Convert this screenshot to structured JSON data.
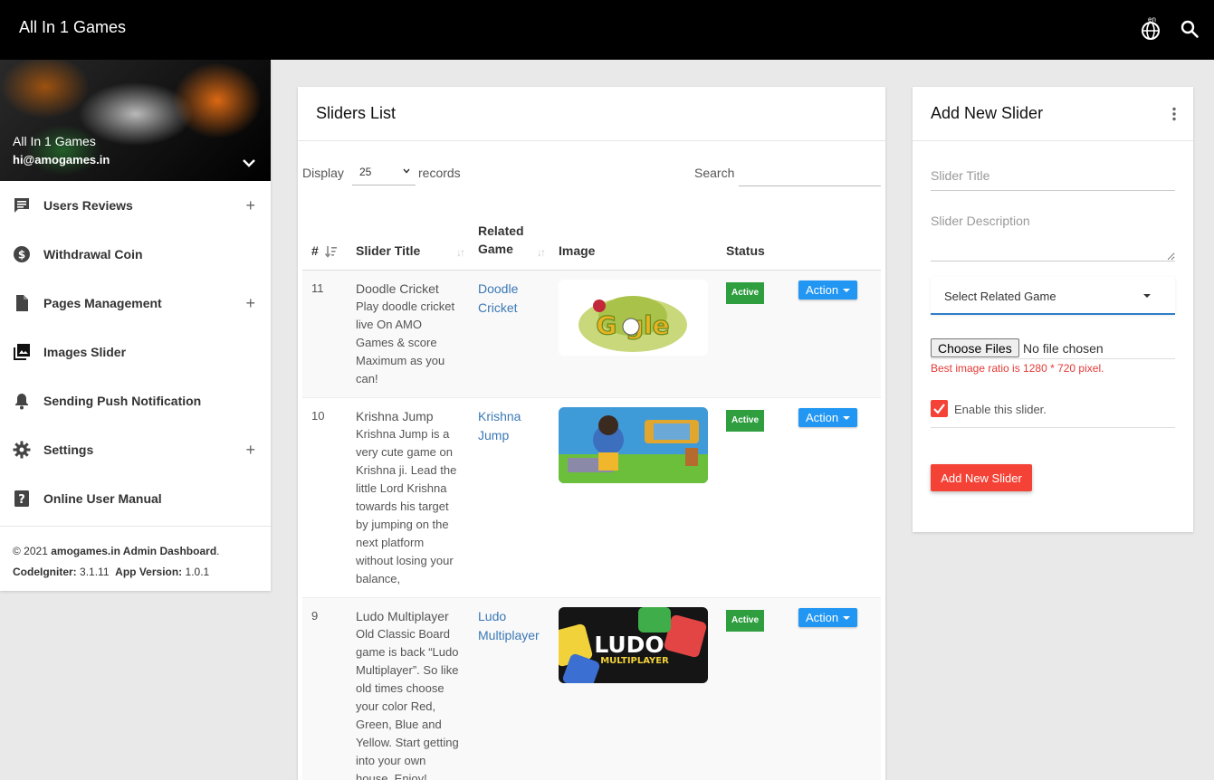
{
  "header": {
    "title": "All In 1 Games",
    "language_badge": "en"
  },
  "sidebar": {
    "profile": {
      "name": "All In 1 Games",
      "email": "hi@amogames.in"
    },
    "items": [
      {
        "label": "Users Reviews",
        "icon": "comment-icon",
        "expandable": true
      },
      {
        "label": "Withdrawal Coin",
        "icon": "dollar-icon",
        "expandable": false
      },
      {
        "label": "Pages Management",
        "icon": "page-icon",
        "expandable": true
      },
      {
        "label": "Images Slider",
        "icon": "image-slider-icon",
        "expandable": false
      },
      {
        "label": "Sending Push Notification",
        "icon": "bell-icon",
        "expandable": false
      },
      {
        "label": "Settings",
        "icon": "gear-icon",
        "expandable": true
      },
      {
        "label": "Online User Manual",
        "icon": "help-icon",
        "expandable": false
      }
    ],
    "plus_symbol": "+",
    "footer": {
      "copyright": "© 2021",
      "site": "amogames.in Admin Dashboard",
      "period": ".",
      "codeigniter_label": "CodeIgniter:",
      "codeigniter_version": "3.1.11",
      "app_version_label": "App Version:",
      "app_version": "1.0.1"
    }
  },
  "sliders_list": {
    "title": "Sliders List",
    "display_label": "Display",
    "records_per_page": "25",
    "records_label": "records",
    "search_label": "Search",
    "columns": [
      "#",
      "Slider Title",
      "Related Game",
      "Image",
      "Status",
      ""
    ],
    "rows": [
      {
        "id": "11",
        "title": "Doodle Cricket",
        "description": "Play doodle cricket live On AMO Games & score Maximum as you can!",
        "related_game": "Doodle Cricket",
        "image": "doodle-cricket-thumbnail",
        "status": "Active",
        "action": "Action"
      },
      {
        "id": "10",
        "title": "Krishna Jump",
        "description": "Krishna Jump is a very cute game on Krishna ji. Lead the little Lord Krishna towards his target by jumping on the next platform without losing your balance,",
        "related_game": "Krishna Jump",
        "image": "krishna-jump-thumbnail",
        "status": "Active",
        "action": "Action"
      },
      {
        "id": "9",
        "title": "Ludo Multiplayer",
        "description": "Old Classic Board game is back “Ludo Multiplayer”. So like old times choose your color Red, Green, Blue and Yellow. Start getting into your own house. Enjoy!",
        "related_game": "Ludo Multiplayer",
        "image": "ludo-multiplayer-thumbnail",
        "status": "Active",
        "action": "Action"
      }
    ]
  },
  "add_slider": {
    "title": "Add New Slider",
    "title_placeholder": "Slider Title",
    "description_placeholder": "Slider Description",
    "related_game_select": "Select Related Game",
    "choose_files": "Choose Files",
    "no_file": "No file chosen",
    "ratio_hint": "Best image ratio is 1280 * 720 pixel.",
    "enable_label": "Enable this slider.",
    "enable_checked": true,
    "submit": "Add New Slider"
  },
  "colors": {
    "topbar": "#000000",
    "accent_red": "#f44336",
    "action_blue": "#2196f3",
    "active_green": "#2e9e3f",
    "link_blue": "#3b78b5"
  }
}
